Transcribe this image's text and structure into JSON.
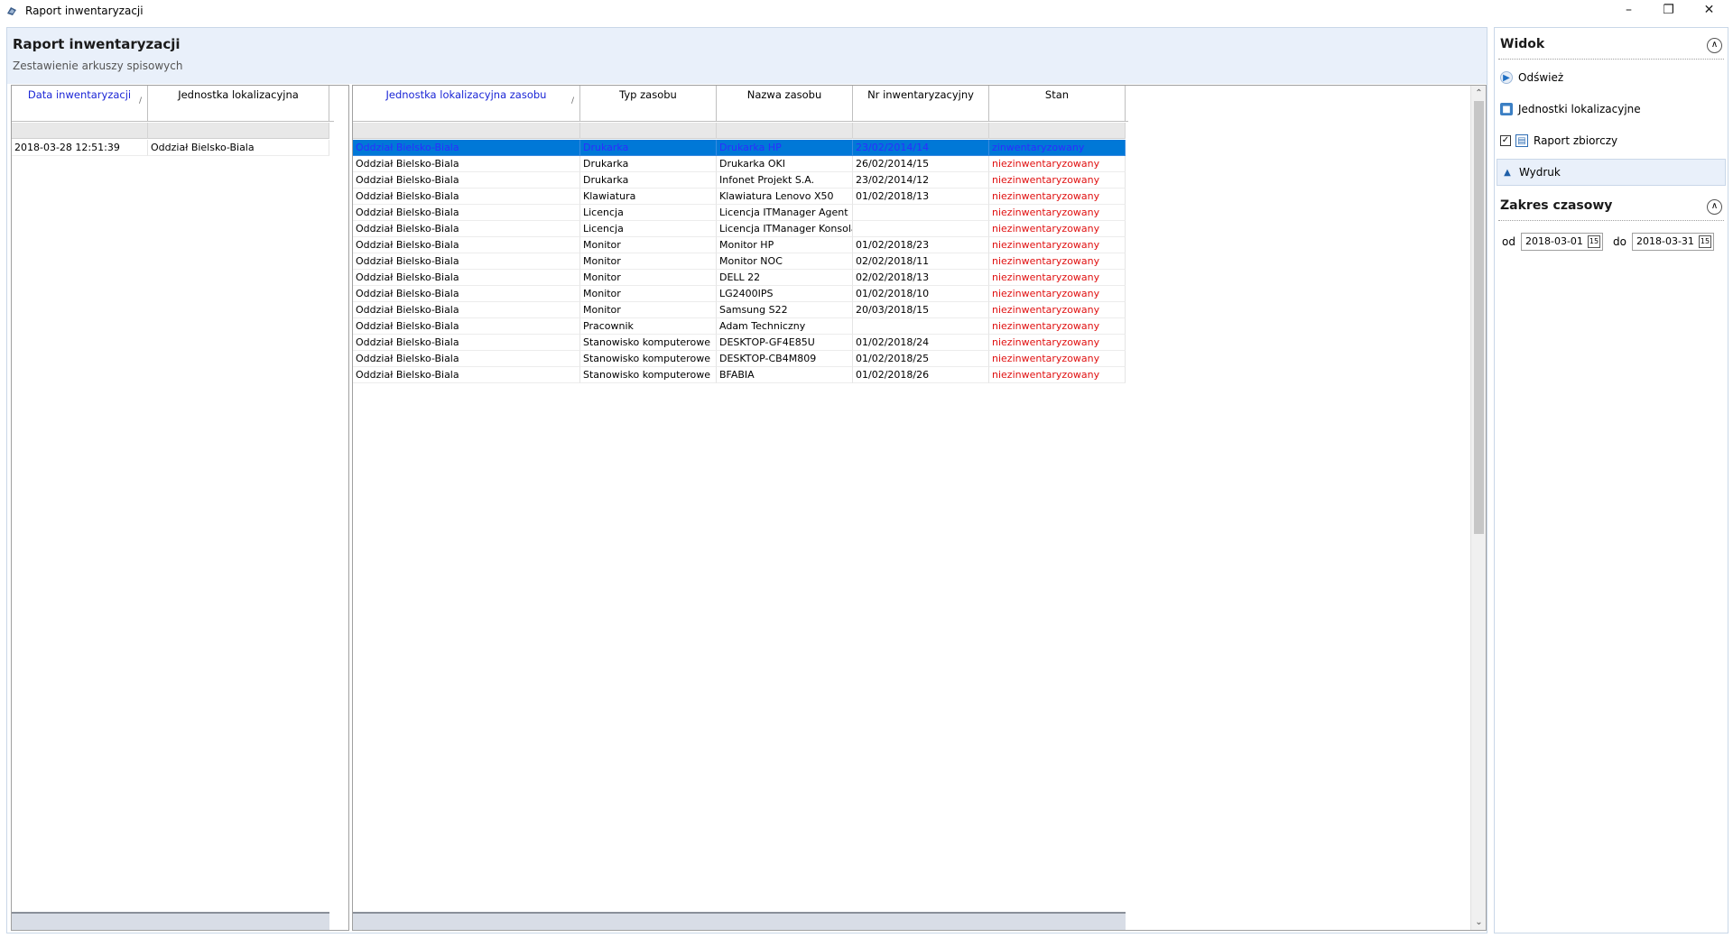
{
  "window": {
    "title": "Raport inwentaryzacji"
  },
  "header": {
    "title": "Raport inwentaryzacji",
    "subtitle": "Zestawienie arkuszy spisowych"
  },
  "left_grid": {
    "columns": [
      "Data inwentaryzacji",
      "Jednostka lokalizacyjna"
    ],
    "rows": [
      [
        "2018-03-28 12:51:39",
        "Oddział Bielsko-Biala"
      ]
    ]
  },
  "main_grid": {
    "columns": [
      "Jednostka lokalizacyjna zasobu",
      "Typ zasobu",
      "Nazwa zasobu",
      "Nr inwentaryzacyjny",
      "Stan"
    ],
    "rows": [
      [
        "Oddział Bielsko-Biala",
        "Drukarka",
        "Drukarka HP",
        "23/02/2014/14",
        "zinwentaryzowany"
      ],
      [
        "Oddział Bielsko-Biala",
        "Drukarka",
        "Drukarka OKI",
        "26/02/2014/15",
        "niezinwentaryzowany"
      ],
      [
        "Oddział Bielsko-Biala",
        "Drukarka",
        "Infonet Projekt S.A.",
        "23/02/2014/12",
        "niezinwentaryzowany"
      ],
      [
        "Oddział Bielsko-Biala",
        "Klawiatura",
        "Klawiatura Lenovo X50",
        "01/02/2018/13",
        "niezinwentaryzowany"
      ],
      [
        "Oddział Bielsko-Biala",
        "Licencja",
        "Licencja ITManager Agent",
        "",
        "niezinwentaryzowany"
      ],
      [
        "Oddział Bielsko-Biala",
        "Licencja",
        "Licencja ITManager Konsola",
        "",
        "niezinwentaryzowany"
      ],
      [
        "Oddział Bielsko-Biala",
        "Monitor",
        "Monitor HP",
        "01/02/2018/23",
        "niezinwentaryzowany"
      ],
      [
        "Oddział Bielsko-Biala",
        "Monitor",
        "Monitor NOC",
        "02/02/2018/11",
        "niezinwentaryzowany"
      ],
      [
        "Oddział Bielsko-Biala",
        "Monitor",
        "DELL 22",
        "02/02/2018/13",
        "niezinwentaryzowany"
      ],
      [
        "Oddział Bielsko-Biala",
        "Monitor",
        "LG2400IPS",
        "01/02/2018/10",
        "niezinwentaryzowany"
      ],
      [
        "Oddział Bielsko-Biala",
        "Monitor",
        "Samsung S22",
        "20/03/2018/15",
        "niezinwentaryzowany"
      ],
      [
        "Oddział Bielsko-Biala",
        "Pracownik",
        "Adam Techniczny",
        "",
        "niezinwentaryzowany"
      ],
      [
        "Oddział Bielsko-Biala",
        "Stanowisko komputerowe",
        "DESKTOP-GF4E85U",
        "01/02/2018/24",
        "niezinwentaryzowany"
      ],
      [
        "Oddział Bielsko-Biala",
        "Stanowisko komputerowe",
        "DESKTOP-CB4M809",
        "01/02/2018/25",
        "niezinwentaryzowany"
      ],
      [
        "Oddział Bielsko-Biala",
        "Stanowisko komputerowe",
        "BFABIA",
        "01/02/2018/26",
        "niezinwentaryzowany"
      ]
    ],
    "selected_row": 0
  },
  "sidebar": {
    "view_title": "Widok",
    "items": [
      {
        "label": "Odśwież",
        "icon": "refresh-icon"
      },
      {
        "label": "Jednostki lokalizacyjne",
        "icon": "location-units-icon"
      },
      {
        "label": "Raport zbiorczy",
        "icon": "summary-report-icon",
        "checked": true
      },
      {
        "label": "Wydruk",
        "icon": "print-icon"
      }
    ],
    "time_title": "Zakres czasowy",
    "from_label": "od",
    "from_value": "2018-03-01",
    "to_label": "do",
    "to_value": "2018-03-31"
  },
  "colors": {
    "selection": "#0078d7",
    "sorted_header": "#1a25d6",
    "status_missing": "#e01010",
    "header_band": "#e9f0fa"
  }
}
